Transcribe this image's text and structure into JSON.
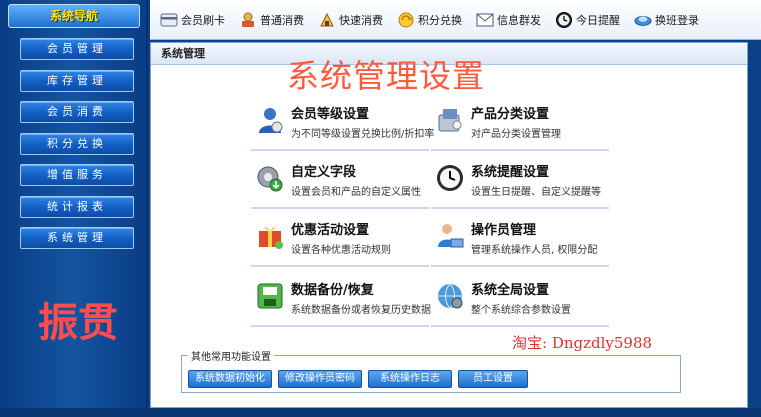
{
  "sidebar": {
    "header": "系统导航",
    "items": [
      {
        "label": "会员管理"
      },
      {
        "label": "库存管理"
      },
      {
        "label": "会员消费"
      },
      {
        "label": "积分兑换"
      },
      {
        "label": "增值服务"
      },
      {
        "label": "统计报表"
      },
      {
        "label": "系统管理"
      }
    ],
    "brand": "振贯"
  },
  "toolbar": {
    "items": [
      {
        "label": "会员刷卡",
        "icon": "card-icon"
      },
      {
        "label": "普通消费",
        "icon": "cashier-icon"
      },
      {
        "label": "快速消费",
        "icon": "fast-consume-icon"
      },
      {
        "label": "积分兑换",
        "icon": "points-icon"
      },
      {
        "label": "信息群发",
        "icon": "message-icon"
      },
      {
        "label": "今日提醒",
        "icon": "clock-icon"
      },
      {
        "label": "换班登录",
        "icon": "shift-icon"
      }
    ]
  },
  "main": {
    "panel_title": "系统管理",
    "big_title": "系统管理设置",
    "tiles": [
      {
        "title": "会员等级设置",
        "desc": "为不同等级设置兑换比例/折扣率",
        "icon": "member-level-icon"
      },
      {
        "title": "产品分类设置",
        "desc": "对产品分类设置管理",
        "icon": "product-category-icon"
      },
      {
        "title": "自定义字段",
        "desc": "设置会员和产品的自定义属性",
        "icon": "custom-field-icon"
      },
      {
        "title": "系统提醒设置",
        "desc": "设置生日提醒、自定义提醒等",
        "icon": "reminder-clock-icon"
      },
      {
        "title": "优惠活动设置",
        "desc": "设置各种优惠活动规则",
        "icon": "promotion-icon"
      },
      {
        "title": "操作员管理",
        "desc": "管理系统操作人员, 权限分配",
        "icon": "operator-icon"
      },
      {
        "title": "数据备份/恢复",
        "desc": "系统数据备份或者恢复历史数据",
        "icon": "backup-icon"
      },
      {
        "title": "系统全局设置",
        "desc": "整个系统综合参数设置",
        "icon": "global-settings-icon"
      }
    ],
    "other": {
      "legend": "其他常用功能设置",
      "buttons": [
        {
          "label": "系统数据初始化"
        },
        {
          "label": "修改操作员密码"
        },
        {
          "label": "系统操作日志"
        },
        {
          "label": "员工设置"
        }
      ]
    },
    "shop_text": "淘宝: Dngzdly5988"
  },
  "colors": {
    "sidebar_bg": "#0b3f86",
    "nav_button": "#1460c4",
    "title_red": "#ff5a3c",
    "brand_red": "#ff4d4d",
    "header_yellow": "#ffe600"
  }
}
